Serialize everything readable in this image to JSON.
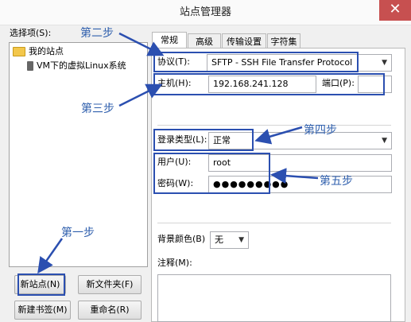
{
  "window": {
    "title": "站点管理器",
    "close_glyph": "✕"
  },
  "left": {
    "select_label": "选择项(S):",
    "tree": [
      {
        "label": "我的站点",
        "icon": "folder-icon"
      },
      {
        "label": "VM下的虚拟Linux系统",
        "icon": "computer-icon"
      }
    ],
    "buttons": {
      "new_site": "新站点(N)",
      "new_folder": "新文件夹(F)",
      "new_bookmark": "新建书签(M)",
      "rename": "重命名(R)"
    }
  },
  "tabs": [
    "常规",
    "高级",
    "传输设置",
    "字符集"
  ],
  "general": {
    "protocol_label": "协议(T):",
    "protocol_value": "SFTP - SSH File Transfer Protocol",
    "host_label": "主机(H):",
    "host_value": "192.168.241.128",
    "port_label": "端口(P):",
    "port_value": "",
    "login_type_label": "登录类型(L):",
    "login_type_value": "正常",
    "user_label": "用户(U):",
    "user_value": "root",
    "password_label": "密码(W):",
    "password_value": "●●●●●●●●●",
    "bg_color_label": "背景颜色(B)",
    "bg_color_value": "无",
    "notes_label": "注释(M):"
  },
  "annotations": {
    "step1": "第一步",
    "step2": "第二步",
    "step3": "第三步",
    "step4": "第四步",
    "step5": "第五步",
    "color": "#2b4fb0"
  }
}
